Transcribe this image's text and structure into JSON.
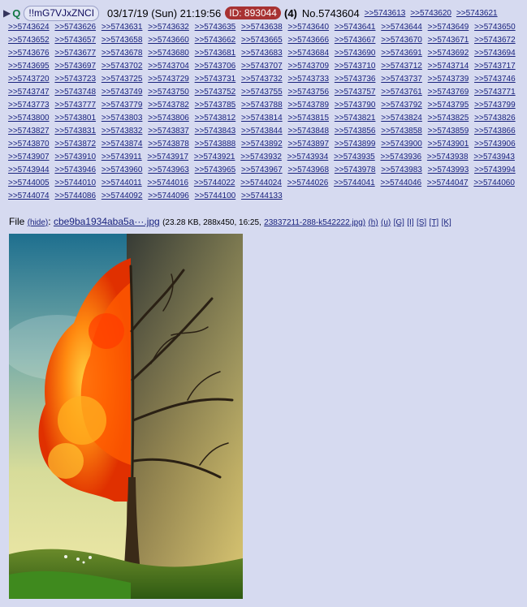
{
  "header": {
    "arrow": "▶",
    "name": "Q",
    "tripcode": "!!mG7VJxZNCI",
    "datetime": "03/17/19 (Sun) 21:19:56",
    "id_label": "ID: 893044",
    "post_count": "(4)",
    "post_number": "No.5743604",
    "header_links": [
      ">>5743613",
      ">>5743620",
      ">>5743621"
    ]
  },
  "backlinks": [
    ">>5743624",
    ">>5743626",
    ">>5743631",
    ">>5743632",
    ">>5743635",
    ">>5743638",
    ">>5743640",
    ">>5743641",
    ">>5743644",
    ">>5743649",
    ">>5743650",
    ">>5743652",
    ">>5743657",
    ">>5743658",
    ">>5743660",
    ">>5743662",
    ">>5743665",
    ">>5743666",
    ">>5743667",
    ">>5743670",
    ">>5743671",
    ">>5743672",
    ">>5743676",
    ">>5743677",
    ">>5743678",
    ">>5743680",
    ">>5743681",
    ">>5743683",
    ">>5743684",
    ">>5743690",
    ">>5743691",
    ">>5743692",
    ">>5743694",
    ">>5743695",
    ">>5743697",
    ">>5743702",
    ">>5743704",
    ">>5743706",
    ">>5743707",
    ">>5743709",
    ">>5743710",
    ">>5743712",
    ">>5743714",
    ">>5743717",
    ">>5743720",
    ">>5743723",
    ">>5743725",
    ">>5743729",
    ">>5743731",
    ">>5743732",
    ">>5743733",
    ">>5743736",
    ">>5743737",
    ">>5743739",
    ">>5743746",
    ">>5743747",
    ">>5743748",
    ">>5743749",
    ">>5743750",
    ">>5743752",
    ">>5743755",
    ">>5743756",
    ">>5743757",
    ">>5743761",
    ">>5743769",
    ">>5743771",
    ">>5743773",
    ">>5743777",
    ">>5743779",
    ">>5743782",
    ">>5743785",
    ">>5743788",
    ">>5743789",
    ">>5743790",
    ">>5743792",
    ">>5743795",
    ">>5743799",
    ">>5743800",
    ">>5743801",
    ">>5743803",
    ">>5743806",
    ">>5743812",
    ">>5743814",
    ">>5743815",
    ">>5743821",
    ">>5743824",
    ">>5743825",
    ">>5743826",
    ">>5743827",
    ">>5743831",
    ">>5743832",
    ">>5743837",
    ">>5743843",
    ">>5743844",
    ">>5743848",
    ">>5743856",
    ">>5743858",
    ">>5743859",
    ">>5743866",
    ">>5743870",
    ">>5743872",
    ">>5743874",
    ">>5743878",
    ">>5743888",
    ">>5743892",
    ">>5743897",
    ">>5743899",
    ">>5743900",
    ">>5743901",
    ">>5743906",
    ">>5743907",
    ">>5743910",
    ">>5743911",
    ">>5743917",
    ">>5743921",
    ">>5743932",
    ">>5743934",
    ">>5743935",
    ">>5743936",
    ">>5743938",
    ">>5743943",
    ">>5743944",
    ">>5743946",
    ">>5743960",
    ">>5743963",
    ">>5743965",
    ">>5743967",
    ">>5743968",
    ">>5743978",
    ">>5743983",
    ">>5743993",
    ">>5743994",
    ">>5744005",
    ">>5744010",
    ">>5744011",
    ">>5744016",
    ">>5744022",
    ">>5744024",
    ">>5744026",
    ">>5744041",
    ">>5744046",
    ">>5744047",
    ">>5744060",
    ">>5744074",
    ">>5744086",
    ">>5744092",
    ">>5744096",
    ">>5744100",
    ">>5744133"
  ],
  "file": {
    "label": "File",
    "hide": "(hide)",
    "filename": "cbe9ba1934aba5a···.jpg",
    "meta": "(23.28 KB, 288x450, 16:25,",
    "original_name": "23837211-288-k542222.jpg)",
    "actions": [
      "(h)",
      "(u)",
      "[G]",
      "[I]",
      "[S]",
      "[T]",
      "[K]"
    ]
  },
  "image": {
    "subject": "half-autumn, half-bare tree painting",
    "colors": {
      "sky_top": "#1e6f8f",
      "sky_mid": "#c9d39a",
      "fire": "#ff4a00",
      "gold": "#ffb020",
      "ground": "#3f8a1e",
      "dark": "#2a2014"
    }
  },
  "style": {
    "background": "#d6daf0",
    "link_color": "#1a237e",
    "name_color": "#117743",
    "id_bg": "#a83232"
  }
}
